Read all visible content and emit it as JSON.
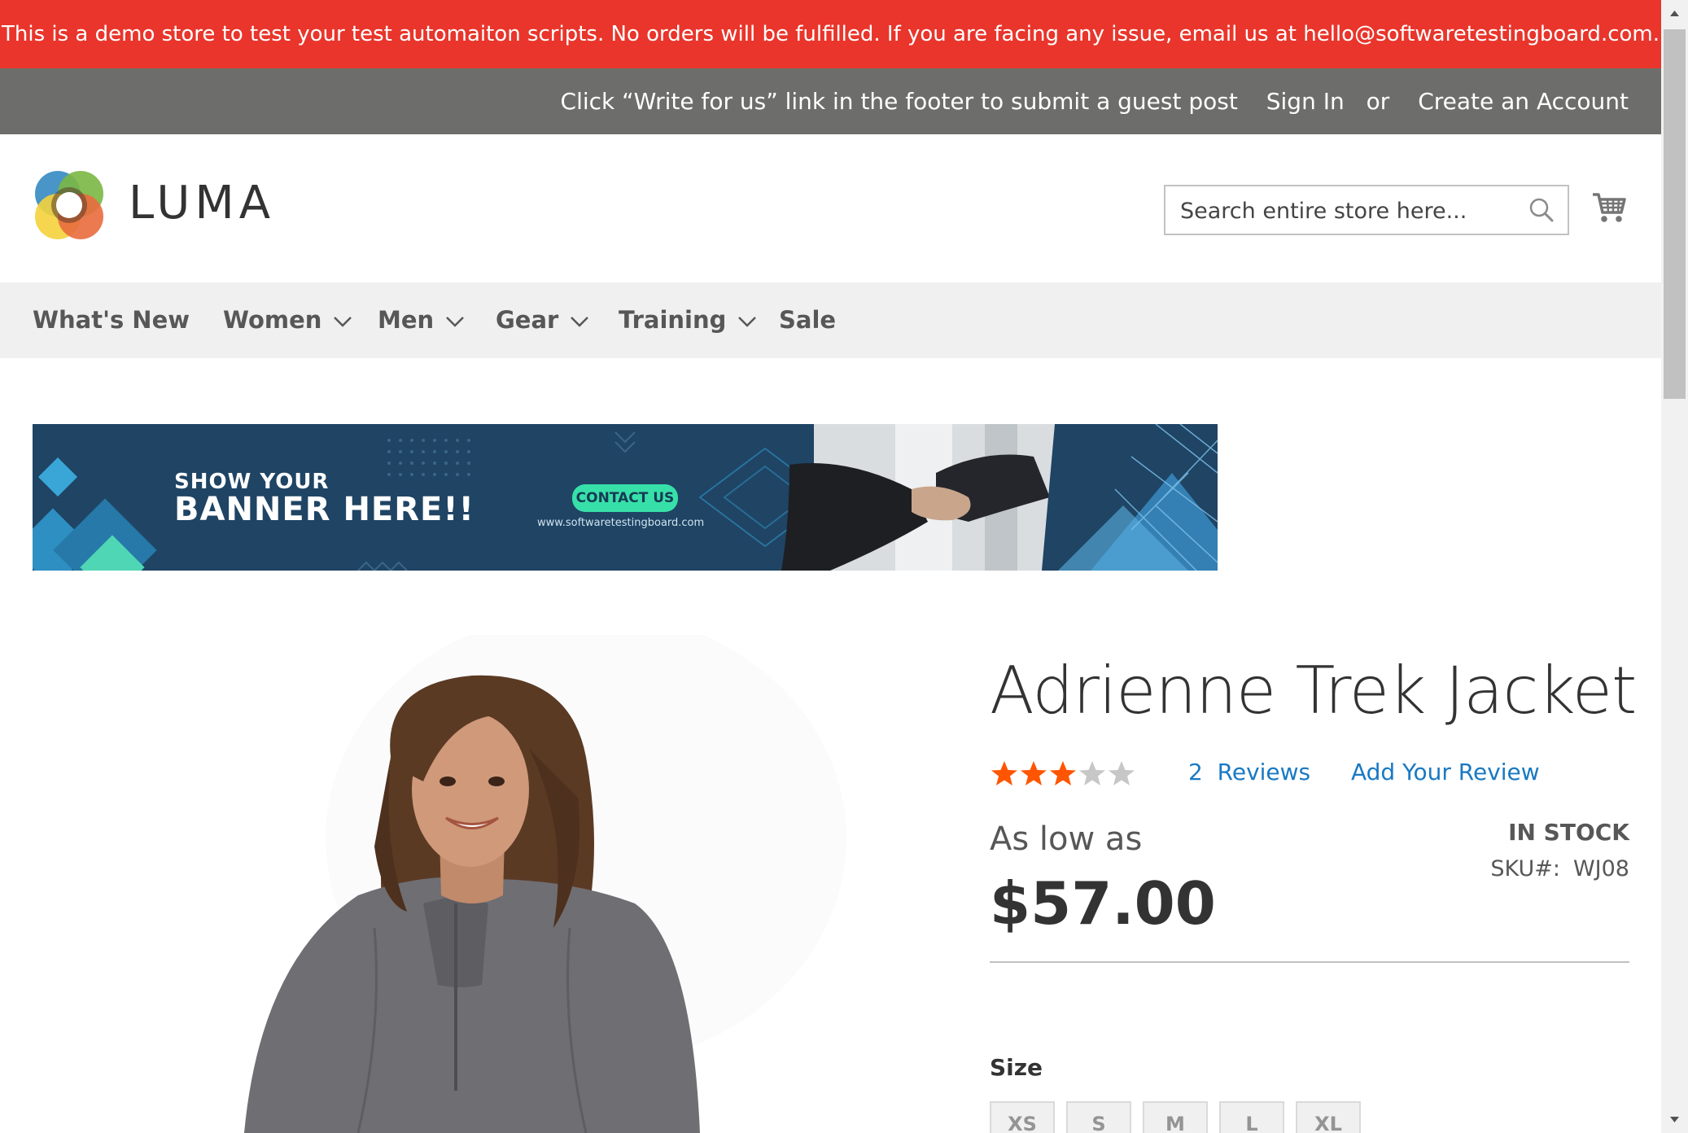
{
  "demo_notice": "This is a demo store to test your test automaiton scripts. No orders will be fulfilled. If you are facing any issue, email us at hello@softwaretestingboard.com.",
  "panel": {
    "guest_post": "Click “Write for us” link in the footer to submit a guest post",
    "sign_in": "Sign In",
    "or": "or",
    "create_account": "Create an Account"
  },
  "logo": {
    "text": "LUMA"
  },
  "search": {
    "placeholder": "Search entire store here..."
  },
  "nav": {
    "items": [
      {
        "label": "What's New",
        "has_dropdown": false
      },
      {
        "label": "Women",
        "has_dropdown": true
      },
      {
        "label": "Men",
        "has_dropdown": true
      },
      {
        "label": "Gear",
        "has_dropdown": true
      },
      {
        "label": "Training",
        "has_dropdown": true
      },
      {
        "label": "Sale",
        "has_dropdown": false
      }
    ]
  },
  "promo_banner": {
    "line1": "SHOW YOUR",
    "line2": "BANNER HERE!!",
    "button": "CONTACT US",
    "url": "www.softwaretestingboard.com"
  },
  "product": {
    "title": "Adrienne Trek Jacket",
    "rating": 3,
    "rating_max": 5,
    "reviews_count": "2",
    "reviews_label": "Reviews",
    "add_review": "Add Your Review",
    "price_prefix": "As low as",
    "price": "$57.00",
    "stock": "IN STOCK",
    "sku_label": "SKU#:",
    "sku": "WJ08",
    "size_label": "Size",
    "sizes": [
      "XS",
      "S",
      "M",
      "L",
      "XL"
    ]
  },
  "colors": {
    "notice_bg": "#e9352b",
    "panel_bg": "#6d6e6b",
    "nav_bg": "#f0f0f0",
    "link": "#1979c3",
    "star_on": "#ff5501",
    "star_off": "#c7c7c7"
  }
}
